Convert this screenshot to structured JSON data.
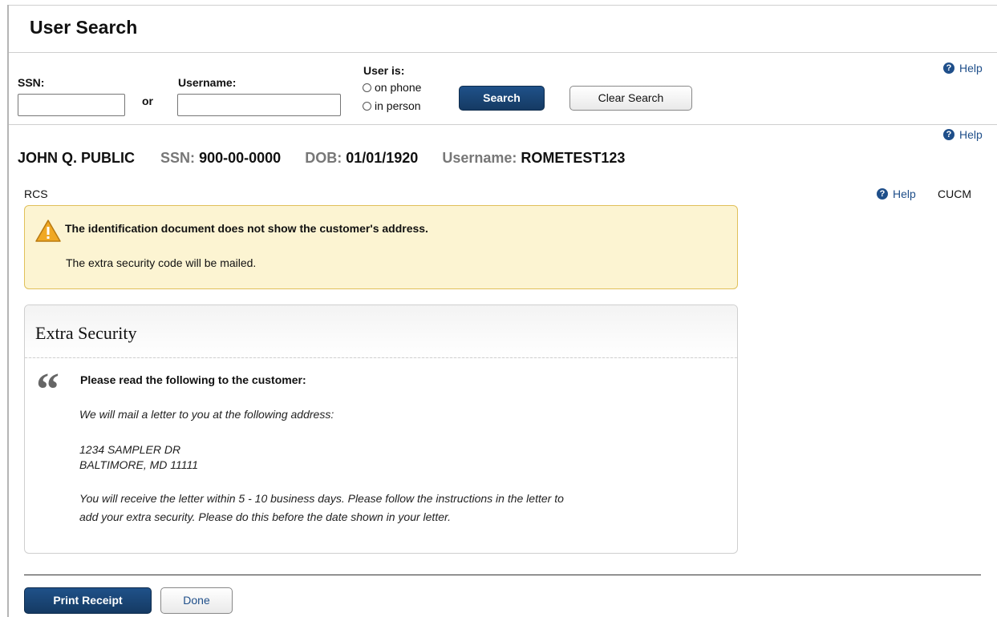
{
  "page": {
    "title": "User Search"
  },
  "search": {
    "ssn_label": "SSN:",
    "ssn_value": "",
    "or_label": "or",
    "username_label": "Username:",
    "username_value": "",
    "user_is_label": "User is:",
    "radio_options": [
      "on phone",
      "in person"
    ],
    "search_button": "Search",
    "clear_button": "Clear Search",
    "help": "Help"
  },
  "customer": {
    "help": "Help",
    "name": "JOHN Q. PUBLIC",
    "ssn_label": "SSN:",
    "ssn_value": "900-00-0000",
    "dob_label": "DOB:",
    "dob_value": "01/01/1920",
    "username_label": "Username:",
    "username_value": "ROMETEST123"
  },
  "context_bar": {
    "left_label": "RCS",
    "help": "Help",
    "right_label": "CUCM"
  },
  "warning": {
    "icon": "warning-triangle-icon",
    "title": "The identification document does not show the customer's address.",
    "body": "The extra security code will be mailed."
  },
  "extra_security": {
    "title": "Extra Security",
    "instruction": "Please read the following to the customer:",
    "line1": "We will mail a letter to you at the following address:",
    "address_line1": "1234 SAMPLER DR",
    "address_line2": "BALTIMORE, MD 11111",
    "closing_line1": "You will receive the letter within 5 - 10 business days. Please follow the instructions in the letter to",
    "closing_line2": "add your extra security. Please do this before the date shown in your letter."
  },
  "footer": {
    "print_button": "Print Receipt",
    "done_button": "Done"
  },
  "colors": {
    "primary_button": "#17426f",
    "help_link": "#1f4f8a",
    "warning_bg": "#fcf4d2",
    "warning_border": "#e0c05a"
  }
}
